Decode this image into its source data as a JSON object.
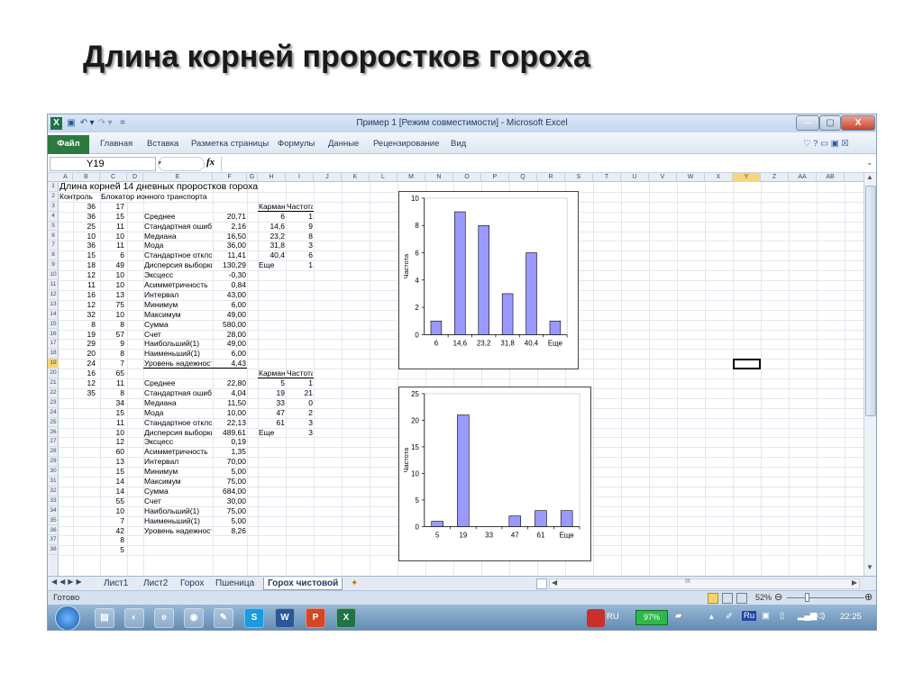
{
  "slide": {
    "title": "Длина корней проростков гороха"
  },
  "window": {
    "title": "Пример 1  [Режим совместимости]  -  Microsoft Excel",
    "qat": [
      "X",
      "▣",
      "↶",
      "▾",
      "↷",
      "▾",
      "="
    ],
    "controls": {
      "minimize": "—",
      "maximize": "▢",
      "close": "X"
    }
  },
  "ribbon": {
    "file": "Файл",
    "tabs": [
      "Главная",
      "Вставка",
      "Разметка страницы",
      "Формулы",
      "Данные",
      "Рецензирование",
      "Вид"
    ],
    "right": "♡  ?  ▭  ▣  ☒"
  },
  "formula": {
    "namebox": "Y19",
    "fx": "fx",
    "value": ""
  },
  "columns": [
    "A",
    "B",
    "C",
    "D",
    "E",
    "F",
    "G",
    "H",
    "I",
    "J",
    "K",
    "L",
    "M",
    "N",
    "O",
    "P",
    "Q",
    "R",
    "S",
    "T",
    "U",
    "V",
    "W",
    "X",
    "Y",
    "Z",
    "AA",
    "AB"
  ],
  "rows": [
    "1",
    "2",
    "3",
    "4",
    "5",
    "6",
    "7",
    "8",
    "9",
    "10",
    "11",
    "12",
    "13",
    "14",
    "15",
    "16",
    "17",
    "18",
    "19",
    "20",
    "21",
    "22",
    "23",
    "24",
    "25",
    "26",
    "27",
    "28",
    "29",
    "30",
    "31",
    "32",
    "33",
    "34",
    "35",
    "36",
    "37",
    "38"
  ],
  "sheet": {
    "title": "Длина корней 14 дневных проростков гороха",
    "header_a": "Контроль",
    "header_c": "Блокатор ионного транспорта",
    "col_a": [
      "36",
      "36",
      "25",
      "10",
      "36",
      "15",
      "18",
      "12",
      "11",
      "16",
      "12",
      "32",
      "8",
      "19",
      "29",
      "20",
      "24",
      "16",
      "12",
      "35"
    ],
    "col_c": [
      "17",
      "15",
      "11",
      "10",
      "11",
      "6",
      "49",
      "10",
      "10",
      "13",
      "75",
      "10",
      "8",
      "57",
      "9",
      "8",
      "7",
      "65",
      "11",
      "8",
      "34",
      "15",
      "11",
      "10",
      "12",
      "60",
      "13",
      "15",
      "14",
      "14",
      "55",
      "10",
      "7",
      "42",
      "8",
      "5"
    ],
    "stat_labels": [
      "Среднее",
      "Стандартная ошибка",
      "Медиана",
      "Мода",
      "Стандартное отклонение",
      "Дисперсия выборки",
      "Эксцесс",
      "Асимметричность",
      "Интервал",
      "Минимум",
      "Максимум",
      "Сумма",
      "Счет",
      "Наибольший(1)",
      "Наименьший(1)",
      "Уровень надежности(95,0%)"
    ],
    "stats1": [
      "20,71",
      "2,16",
      "16,50",
      "36,00",
      "11,41",
      "130,29",
      "-0,30",
      "0,84",
      "43,00",
      "6,00",
      "49,00",
      "580,00",
      "28,00",
      "49,00",
      "6,00",
      "4,43"
    ],
    "stats2": [
      "22,80",
      "4,04",
      "11,50",
      "10,00",
      "22,13",
      "489,61",
      "0,19",
      "1,35",
      "70,00",
      "5,00",
      "75,00",
      "684,00",
      "30,00",
      "75,00",
      "5,00",
      "8,26"
    ],
    "bins_hdr": [
      "Карман",
      "Частота"
    ],
    "bins1": [
      [
        "6",
        "1"
      ],
      [
        "14,6",
        "9"
      ],
      [
        "23,2",
        "8"
      ],
      [
        "31,8",
        "3"
      ],
      [
        "40,4",
        "6"
      ],
      [
        "Еще",
        "1"
      ]
    ],
    "bins2": [
      [
        "5",
        "1"
      ],
      [
        "19",
        "21"
      ],
      [
        "33",
        "0"
      ],
      [
        "47",
        "2"
      ],
      [
        "61",
        "3"
      ],
      [
        "Еще",
        "3"
      ]
    ]
  },
  "chart_data": [
    {
      "type": "bar",
      "categories": [
        "6",
        "14,6",
        "23,2",
        "31,8",
        "40,4",
        "Еще"
      ],
      "values": [
        1,
        9,
        8,
        3,
        6,
        1
      ],
      "ylabel": "Частота",
      "ylim": [
        0,
        10
      ],
      "yticks": [
        "0",
        "2",
        "4",
        "6",
        "8",
        "10"
      ],
      "color": "#9999ff"
    },
    {
      "type": "bar",
      "categories": [
        "5",
        "19",
        "33",
        "47",
        "61",
        "Еще"
      ],
      "values": [
        1,
        21,
        0,
        2,
        3,
        3
      ],
      "ylabel": "Частота",
      "ylim": [
        0,
        25
      ],
      "yticks": [
        "0",
        "5",
        "10",
        "15",
        "20",
        "25"
      ],
      "color": "#9999ff"
    }
  ],
  "sheet_tabs": [
    "Лист1",
    "Лист2",
    "Горох",
    "Пшеница",
    "Горох чистовой"
  ],
  "active_sheet": "Горох чистовой",
  "status": {
    "ready": "Готово",
    "zoom": "52%",
    "hscroll_mark": "III"
  },
  "taskbar": {
    "apps": [
      "▤",
      "◐",
      "e",
      "◉",
      "✎",
      "S",
      "W",
      "P",
      "X"
    ],
    "lang": "RU",
    "battery": "97%",
    "lang2": "Ru",
    "time": "22:25"
  }
}
